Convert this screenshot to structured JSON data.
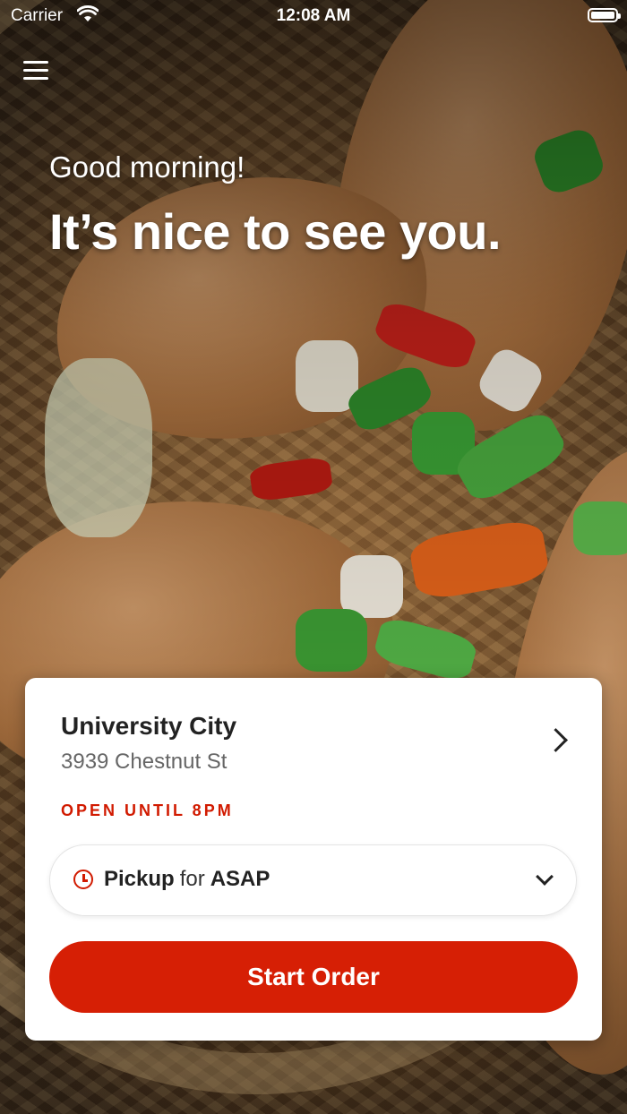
{
  "status_bar": {
    "carrier": "Carrier",
    "time": "12:08 AM"
  },
  "header": {
    "menu_icon": "hamburger-menu-icon",
    "greeting": "Good morning!",
    "headline": "It’s nice to see you."
  },
  "location": {
    "name": "University City",
    "address": "3939 Chestnut St",
    "hours": "OPEN UNTIL 8PM"
  },
  "order_mode": {
    "icon": "clock-icon",
    "mode": "Pickup",
    "connector": "for",
    "time": "ASAP"
  },
  "actions": {
    "start_order": "Start Order"
  },
  "colors": {
    "accent": "#d61f05",
    "hours_text": "#d11a00"
  }
}
